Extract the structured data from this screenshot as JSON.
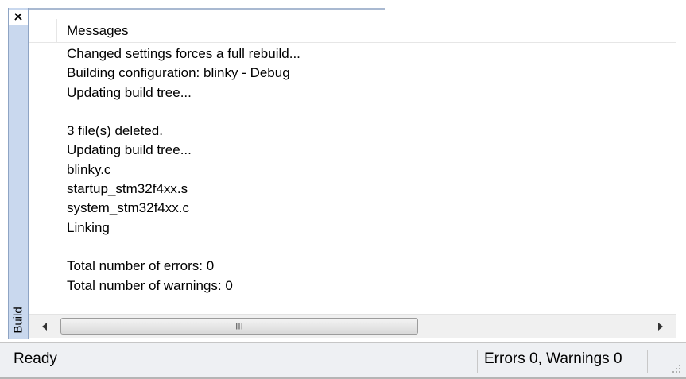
{
  "dock": {
    "close_glyph": "×",
    "tab_label": "Build"
  },
  "panel": {
    "header_label": "Messages",
    "lines": [
      "Changed settings forces a full rebuild...",
      "Building configuration: blinky - Debug",
      "Updating build tree...",
      "",
      "3  file(s) deleted.",
      "Updating build tree...",
      "blinky.c",
      "startup_stm32f4xx.s",
      "system_stm32f4xx.c",
      "Linking",
      "",
      "Total number of errors: 0",
      "Total number of warnings: 0"
    ]
  },
  "scrollbar": {
    "thumb_grip": "III",
    "left_arrow_icon": "scroll-left-arrow-icon",
    "right_arrow_icon": "scroll-right-arrow-icon"
  },
  "statusbar": {
    "status_text": "Ready",
    "summary_text": "Errors 0, Warnings 0"
  },
  "colors": {
    "dock_strip": "#c9d8ee",
    "statusbar_bg": "#eef0f3"
  }
}
